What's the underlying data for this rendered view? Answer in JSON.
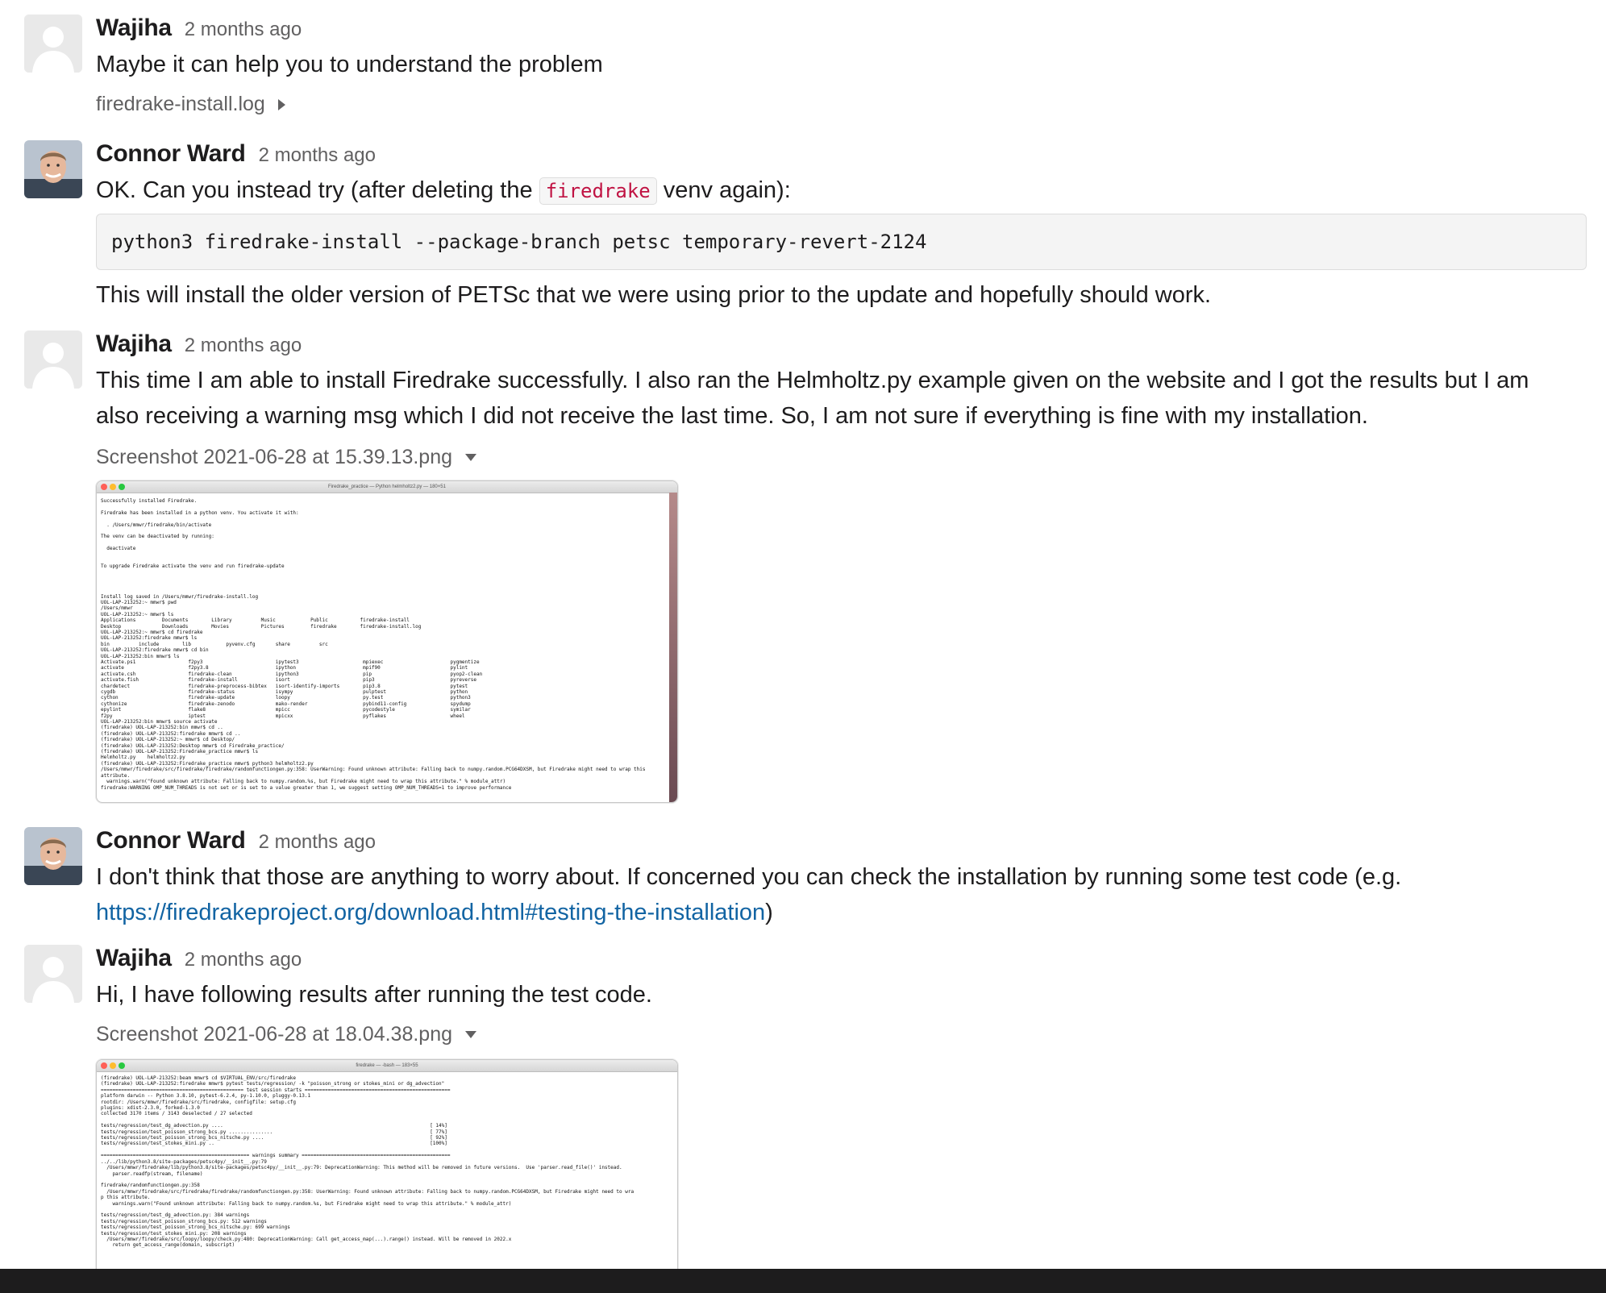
{
  "messages": [
    {
      "author": "Wajiha",
      "time": "2 months ago",
      "text": "Maybe it can help you to understand the problem",
      "file": "firedrake-install.log"
    },
    {
      "author": "Connor Ward",
      "time": "2 months ago",
      "text_before": "OK. Can you instead try (after deleting the ",
      "inline_code": "firedrake",
      "text_after": " venv again):",
      "code_block": "python3 firedrake-install --package-branch petsc temporary-revert-2124",
      "text2": "This will install the older version of PETSc that we were using prior to the update and hopefully should work."
    },
    {
      "author": "Wajiha",
      "time": "2 months ago",
      "text_line1": "This time I am able to install Firedrake successfully. I also ran the Helmholtz.py example given on the website and I got the results but I am",
      "text_line2": "also receiving a warning msg which I did not receive the last time. So, I am not sure if everything is fine with my installation.",
      "file": "Screenshot 2021-06-28 at 15.39.13.png",
      "window_title": "Firedrake_practice — Python helmholtz2.py — 180×51"
    },
    {
      "author": "Connor Ward",
      "time": "2 months ago",
      "text_line1": "I don't think that those are anything to worry about. If concerned you can check the installation by running some test code (e.g.",
      "link": "https://firedrakeproject.org/download.html#testing-the-installation",
      "link_suffix": ")"
    },
    {
      "author": "Wajiha",
      "time": "2 months ago",
      "text": "Hi, I have following results after running the test code.",
      "file": "Screenshot 2021-06-28 at 18.04.38.png",
      "window_title": "firedrake — -bash — 183×55"
    }
  ],
  "terminal1": "Successfully installed Firedrake.\n\nFiredrake has been installed in a python venv. You activate it with:\n\n  . /Users/mmwr/firedrake/bin/activate\n\nThe venv can be deactivated by running:\n\n  deactivate\n\n\nTo upgrade Firedrake activate the venv and run firedrake-update\n\n\n\n\nInstall log saved in /Users/mmwr/firedrake-install.log\nUOL-LAP-213252:~ mmwr$ pwd\n/Users/mmwr\nUOL-LAP-213252:~ mmwr$ ls\nApplications         Documents        Library          Music            Public           firedrake-install\nDesktop              Downloads        Movies           Pictures         firedrake        firedrake-install.log\nUOL-LAP-213252:~ mmwr$ cd firedrake\nUOL-LAP-213252:firedrake mmwr$ ls\nbin          include        lib            pyvenv.cfg       share          src\nUOL-LAP-213252:firedrake mmwr$ cd bin\nUOL-LAP-213252:bin mmwr$ ls\nActivate.ps1                  f2py3                         ipytest3                      mpiexec                       pygmentize\nactivate                      f2py3.8                       ipython                       mpif90                        pylint\nactivate.csh                  firedrake-clean               ipython3                      pip                           pyop2-clean\nactivate.fish                 firedrake-install             isort                         pip3                          pyreverse\nchardetect                    firedrake-preprocess-bibtex   isort-identify-imports        pip3.8                        pytest\ncygdb                         firedrake-status              isympy                        pulptest                      python\ncython                        firedrake-update              loopy                         py.test                       python3\ncythonize                     firedrake-zenodo              mako-render                   pybind11-config               spydump\nepylint                       flake8                        mpicc                         pycodestyle                   symilar\nf2py                          iptest                        mpicxx                        pyflakes                      wheel\nUOL-LAP-213252:bin mmwr$ source activate\n(firedrake) UOL-LAP-213252:bin mmwr$ cd ..\n(firedrake) UOL-LAP-213252:firedrake mmwr$ cd ..\n(firedrake) UOL-LAP-213252:~ mmwr$ cd Desktop/\n(firedrake) UOL-LAP-213252:Desktop mmwr$ cd Firedrake_practice/\n(firedrake) UOL-LAP-213252:Firedrake_practice mmwr$ ls\nHelmholtz.py    helmholtz2.py\n(firedrake) UOL-LAP-213252:Firedrake_practice mmwr$ python3 helmholtz2.py\n/Users/mmwr/firedrake/src/firedrake/firedrake/randomfunctiongen.py:358: UserWarning: Found unknown attribute: Falling back to numpy.random.PCG64DXSM, but Firedrake might need to wrap this\nattribute.\n  warnings.warn(\"Found unknown attribute: Falling back to numpy.random.%s, but Firedrake might need to wrap this attribute.\" % module_attr)\nfiredrake:WARNING OMP_NUM_THREADS is not set or is set to a value greater than 1, we suggest setting OMP_NUM_THREADS=1 to improve performance",
  "terminal2": "(firedrake) UOL-LAP-213252:beam mmwr$ cd $VIRTUAL_ENV/src/firedrake\n(firedrake) UOL-LAP-213252:firedrake mmwr$ pytest tests/regression/ -k \"poisson_strong or stokes_mini or dg_advection\"\n================================================= test session starts ==================================================\nplatform darwin -- Python 3.8.10, pytest-6.2.4, py-1.10.0, pluggy-0.13.1\nrootdir: /Users/mmwr/firedrake/src/firedrake, configfile: setup.cfg\nplugins: xdist-2.3.0, forked-1.3.0\ncollected 3170 items / 3143 deselected / 27 selected\n\ntests/regression/test_dg_advection.py ....                                                                       [ 14%]\ntests/regression/test_poisson_strong_bcs.py ...............                                                      [ 77%]\ntests/regression/test_poisson_strong_bcs_nitsche.py ....                                                         [ 92%]\ntests/regression/test_stokes_mini.py ..                                                                          [100%]\n\n=================================================== warnings summary ===================================================\n../../lib/python3.8/site-packages/petsc4py/__init__.py:79\n  /Users/mmwr/firedrake/lib/python3.8/site-packages/petsc4py/__init__.py:79: DeprecationWarning: This method will be removed in future versions.  Use 'parser.read_file()' instead.\n    parser.readfp(stream, filename)\n\nfiredrake/randomfunctiongen.py:358\n  /Users/mmwr/firedrake/src/firedrake/firedrake/randomfunctiongen.py:358: UserWarning: Found unknown attribute: Falling back to numpy.random.PCG64DXSM, but Firedrake might need to wra\np this attribute.\n    warnings.warn(\"Found unknown attribute: Falling back to numpy.random.%s, but Firedrake might need to wrap this attribute.\" % module_attr)\n\ntests/regression/test_dg_advection.py: 384 warnings\ntests/regression/test_poisson_strong_bcs.py: 512 warnings\ntests/regression/test_poisson_strong_bcs_nitsche.py: 699 warnings\ntests/regression/test_stokes_mini.py: 208 warnings\n  /Users/mmwr/firedrake/src/loopy/loopy/check.py:480: DeprecationWarning: Call get_access_map(...).range() instead. Will be removed in 2022.x\n    return get_access_range(domain, subscript)",
  "colors": {
    "link": "#1264a3",
    "inline_code": "#c01343",
    "muted": "#616061",
    "text": "#1d1c1d"
  }
}
